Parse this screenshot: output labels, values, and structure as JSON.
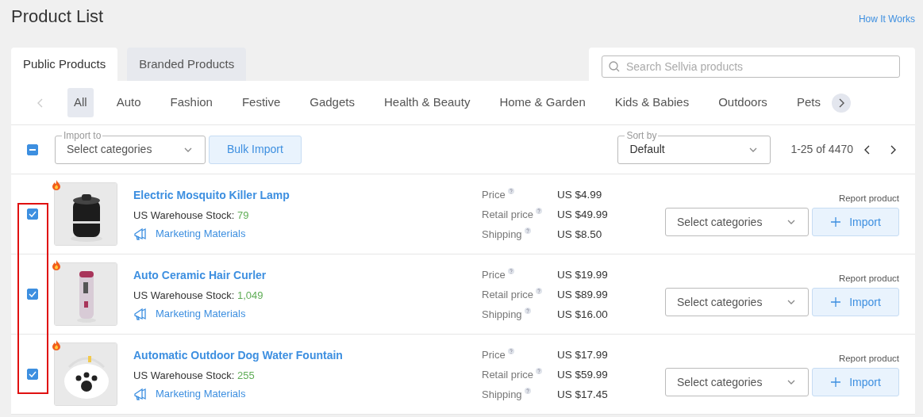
{
  "title": "Product List",
  "help_link": "How It Works",
  "tabs": [
    {
      "label": "Public Products",
      "selected": true
    },
    {
      "label": "Branded Products",
      "selected": false
    }
  ],
  "search": {
    "placeholder": "Search Sellvia products"
  },
  "categories": [
    {
      "label": "All",
      "selected": true
    },
    {
      "label": "Auto",
      "selected": false
    },
    {
      "label": "Fashion",
      "selected": false
    },
    {
      "label": "Festive",
      "selected": false
    },
    {
      "label": "Gadgets",
      "selected": false
    },
    {
      "label": "Health & Beauty",
      "selected": false
    },
    {
      "label": "Home & Garden",
      "selected": false
    },
    {
      "label": "Kids & Babies",
      "selected": false
    },
    {
      "label": "Outdoors",
      "selected": false
    },
    {
      "label": "Pets",
      "selected": false
    }
  ],
  "categories_prev_disabled": true,
  "toolbar": {
    "select_all_partial": true,
    "import_to": {
      "label": "Import to",
      "placeholder": "Select categories"
    },
    "bulk_import": "Bulk Import",
    "sort_by": {
      "label": "Sort by",
      "value": "Default"
    },
    "range": "1-25 of 4470"
  },
  "products": [
    {
      "checked": true,
      "hot": true,
      "kind": "picture",
      "name": "Electric Mosquito Killer Lamp",
      "stock_label": "US Warehouse Stock:",
      "stock": "79",
      "marketing": "Marketing Materials",
      "price_label": "Price",
      "price": "US $4.99",
      "retail_label": "Retail price",
      "retail": "US $49.99",
      "shipping_label": "Shipping",
      "shipping": "US $8.50",
      "report": "Report product",
      "category_placeholder": "Select categories",
      "import": "Import"
    },
    {
      "checked": true,
      "hot": true,
      "kind": "picture",
      "name": "Auto Ceramic Hair Curler",
      "stock_label": "US Warehouse Stock:",
      "stock": "1,049",
      "marketing": "Marketing Materials",
      "price_label": "Price",
      "price": "US $19.99",
      "retail_label": "Retail price",
      "retail": "US $89.99",
      "shipping_label": "Shipping",
      "shipping": "US $16.00",
      "report": "Report product",
      "category_placeholder": "Select categories",
      "import": "Import"
    },
    {
      "checked": true,
      "hot": true,
      "kind": "picture",
      "name": "Automatic Outdoor Dog Water Fountain",
      "stock_label": "US Warehouse Stock:",
      "stock": "255",
      "marketing": "Marketing Materials",
      "price_label": "Price",
      "price": "US $17.99",
      "retail_label": "Retail price",
      "retail": "US $59.99",
      "shipping_label": "Shipping",
      "shipping": "US $17.45",
      "report": "Report product",
      "category_placeholder": "Select categories",
      "import": "Import"
    }
  ]
}
